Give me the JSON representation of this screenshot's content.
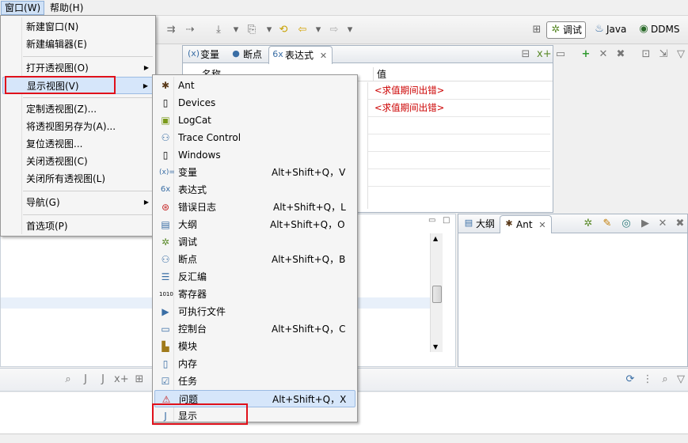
{
  "menubar": {
    "items": [
      {
        "label": "窗口(W)",
        "active": true
      },
      {
        "label": "帮助(H)",
        "active": false
      }
    ]
  },
  "toolbar": {
    "perspectives": [
      {
        "label": "调试",
        "icon": "bug-icon",
        "active": true
      },
      {
        "label": "Java",
        "icon": "java-icon",
        "active": false
      },
      {
        "label": "DDMS",
        "icon": "ddms-icon",
        "active": false
      }
    ]
  },
  "top_view": {
    "tabs": [
      {
        "label": "变量",
        "icon": "variables-icon"
      },
      {
        "label": "断点",
        "icon": "breakpoints-icon"
      },
      {
        "label": "表达式",
        "icon": "expressions-icon",
        "selected": true
      }
    ],
    "columns": [
      "名称",
      "值"
    ],
    "rows": [
      {
        "value": "<求值期间出错>"
      },
      {
        "value": "<求值期间出错>"
      }
    ]
  },
  "outline_view": {
    "tabs": [
      {
        "label": "大纲",
        "icon": "outline-icon"
      },
      {
        "label": "Ant",
        "icon": "ant-icon",
        "selected": true
      }
    ]
  },
  "window_menu": {
    "items": [
      {
        "label": "新建窗口(N)",
        "submenu": false
      },
      {
        "label": "新建编辑器(E)",
        "submenu": false
      },
      {
        "label": "打开透视图(O)",
        "submenu": true
      },
      {
        "label": "显示视图(V)",
        "submenu": true,
        "highlighted": true
      },
      {
        "label": "定制透视图(Z)...",
        "submenu": false
      },
      {
        "label": "将透视图另存为(A)...",
        "submenu": false
      },
      {
        "label": "复位透视图...",
        "submenu": false
      },
      {
        "label": "关闭透视图(C)",
        "submenu": false
      },
      {
        "label": "关闭所有透视图(L)",
        "submenu": false
      },
      {
        "label": "导航(G)",
        "submenu": true
      },
      {
        "label": "首选项(P)",
        "submenu": false
      }
    ]
  },
  "show_view_menu": {
    "items": [
      {
        "label": "Ant",
        "shortcut": "",
        "icon": "ant-icon"
      },
      {
        "label": "Devices",
        "shortcut": "",
        "icon": "device-icon"
      },
      {
        "label": "LogCat",
        "shortcut": "",
        "icon": "logcat-icon"
      },
      {
        "label": "Trace Control",
        "shortcut": "",
        "icon": "trace-control-icon"
      },
      {
        "label": "Windows",
        "shortcut": "",
        "icon": "windows-icon"
      },
      {
        "label": "变量",
        "shortcut": "Alt+Shift+Q，V",
        "icon": "variables-icon"
      },
      {
        "label": "表达式",
        "shortcut": "",
        "icon": "expressions-icon"
      },
      {
        "label": "错误日志",
        "shortcut": "Alt+Shift+Q，L",
        "icon": "error-log-icon"
      },
      {
        "label": "大纲",
        "shortcut": "Alt+Shift+Q，O",
        "icon": "outline-icon"
      },
      {
        "label": "调试",
        "shortcut": "",
        "icon": "debug-icon"
      },
      {
        "label": "断点",
        "shortcut": "Alt+Shift+Q，B",
        "icon": "breakpoints-icon"
      },
      {
        "label": "反汇编",
        "shortcut": "",
        "icon": "disassembly-icon"
      },
      {
        "label": "寄存器",
        "shortcut": "",
        "icon": "registers-icon"
      },
      {
        "label": "可执行文件",
        "shortcut": "",
        "icon": "executables-icon"
      },
      {
        "label": "控制台",
        "shortcut": "Alt+Shift+Q，C",
        "icon": "console-icon"
      },
      {
        "label": "模块",
        "shortcut": "",
        "icon": "modules-icon"
      },
      {
        "label": "内存",
        "shortcut": "",
        "icon": "memory-icon"
      },
      {
        "label": "任务",
        "shortcut": "",
        "icon": "tasks-icon"
      },
      {
        "label": "问题",
        "shortcut": "Alt+Shift+Q，X",
        "icon": "problems-icon",
        "highlighted": true
      },
      {
        "label": "显示",
        "shortcut": "",
        "icon": "display-icon"
      }
    ]
  },
  "colors": {
    "error_text": "#cc0000",
    "annotation_box": "#e0101a",
    "menu_highlight": "#d6e6fa"
  }
}
